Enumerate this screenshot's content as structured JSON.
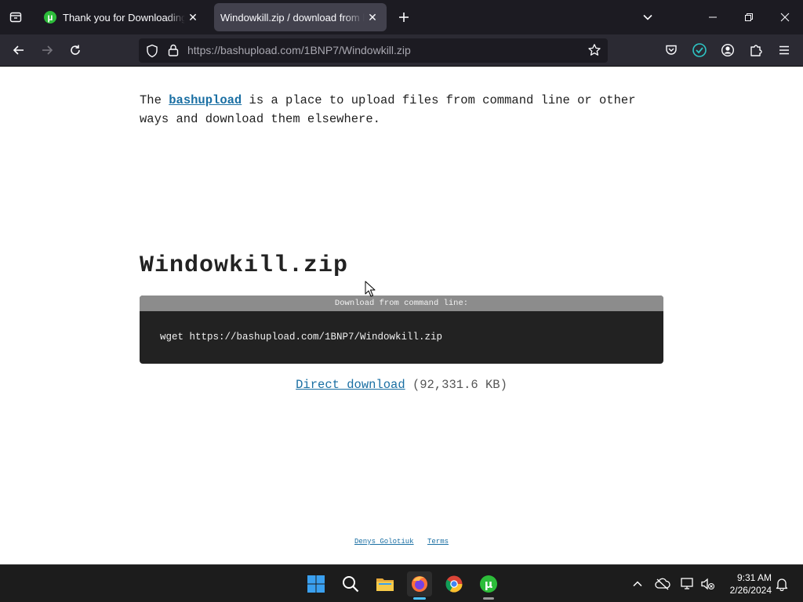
{
  "browser": {
    "tabs": [
      {
        "title": "Thank you for Downloading µTorrent",
        "active": false,
        "favicon": "utorrent-icon"
      },
      {
        "title": "Windowkill.zip / download from bashupload",
        "active": true
      }
    ],
    "url_base": "https://bashupload.com",
    "url_path": "/1BNP7/Windowkill.zip"
  },
  "page": {
    "intro_before": "The ",
    "intro_link": "bashupload",
    "intro_after": " is a place to upload files from command line or other ways and download them elsewhere.",
    "filename": "Windowkill.zip",
    "cmd_header": "Download from command line:",
    "cmd_text": "wget https://bashupload.com/1BNP7/Windowkill.zip",
    "direct_download_label": "Direct download",
    "file_size": "(92,331.6 KB)",
    "footer_author": "Denys Golotiuk",
    "footer_terms": "Terms"
  },
  "taskbar": {
    "apps": [
      "windows-start",
      "search",
      "file-explorer",
      "firefox",
      "chrome",
      "utorrent"
    ],
    "active_app": "firefox",
    "time": "9:31 AM",
    "date": "2/26/2024"
  },
  "colors": {
    "tab_bar": "#1c1b22",
    "nav_bar": "#2b2a33",
    "active_tab": "#42414d",
    "link": "#1a6fa3",
    "cmd_box": "#222222",
    "cmd_header": "#8c8c8c",
    "taskbar": "#1c1c1c"
  }
}
